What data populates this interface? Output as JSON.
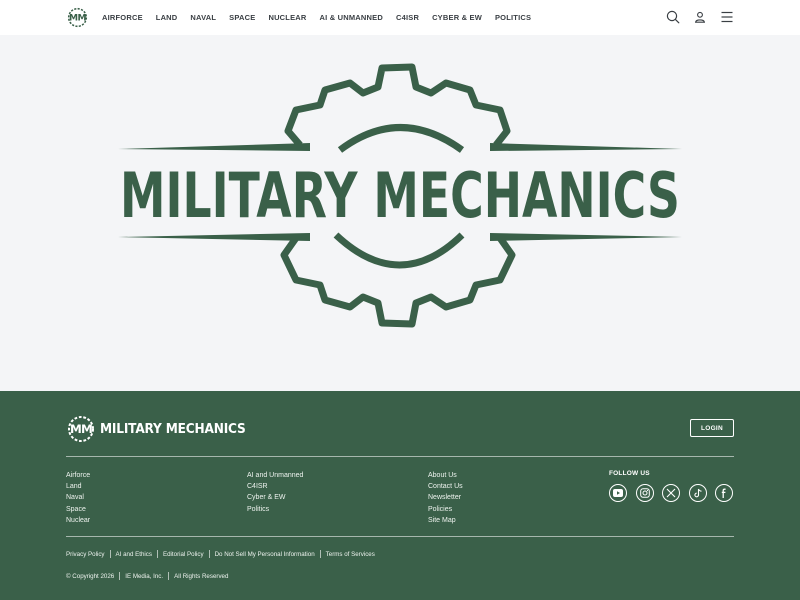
{
  "colors": {
    "brand_green": "#3a6049",
    "header_bg": "#ffffff",
    "hero_bg": "#f4f5f7",
    "nav_text": "#3a3f44"
  },
  "header": {
    "logo_icon": "mm-gear-logo",
    "nav": [
      "AIRFORCE",
      "LAND",
      "NAVAL",
      "SPACE",
      "NUCLEAR",
      "AI & UNMANNED",
      "C4ISR",
      "CYBER & EW",
      "POLITICS"
    ],
    "icons": [
      "search-icon",
      "user-icon",
      "menu-icon"
    ]
  },
  "hero": {
    "logo_text": "MILITARY MECHANICS"
  },
  "footer": {
    "logo_text": "MILITARY MECHANICS",
    "login_label": "LOGIN",
    "columns": [
      [
        "Airforce",
        "Land",
        "Naval",
        "Space",
        "Nuclear"
      ],
      [
        "AI and Unmanned",
        "C4ISR",
        "Cyber & EW",
        "Politics"
      ],
      [
        "About Us",
        "Contact Us",
        "Newsletter",
        "Policies",
        "Site Map"
      ]
    ],
    "follow_title": "FOLLOW US",
    "socials": [
      "youtube-icon",
      "instagram-icon",
      "x-icon",
      "tiktok-icon",
      "facebook-icon"
    ],
    "legal_links": [
      "Privacy Policy",
      "AI and Ethics",
      "Editorial Policy",
      "Do Not Sell My Personal Information",
      "Terms of Services"
    ],
    "copyright": [
      "© Copyright 2026",
      "IE Media, Inc.",
      "All Rights Reserved"
    ]
  }
}
